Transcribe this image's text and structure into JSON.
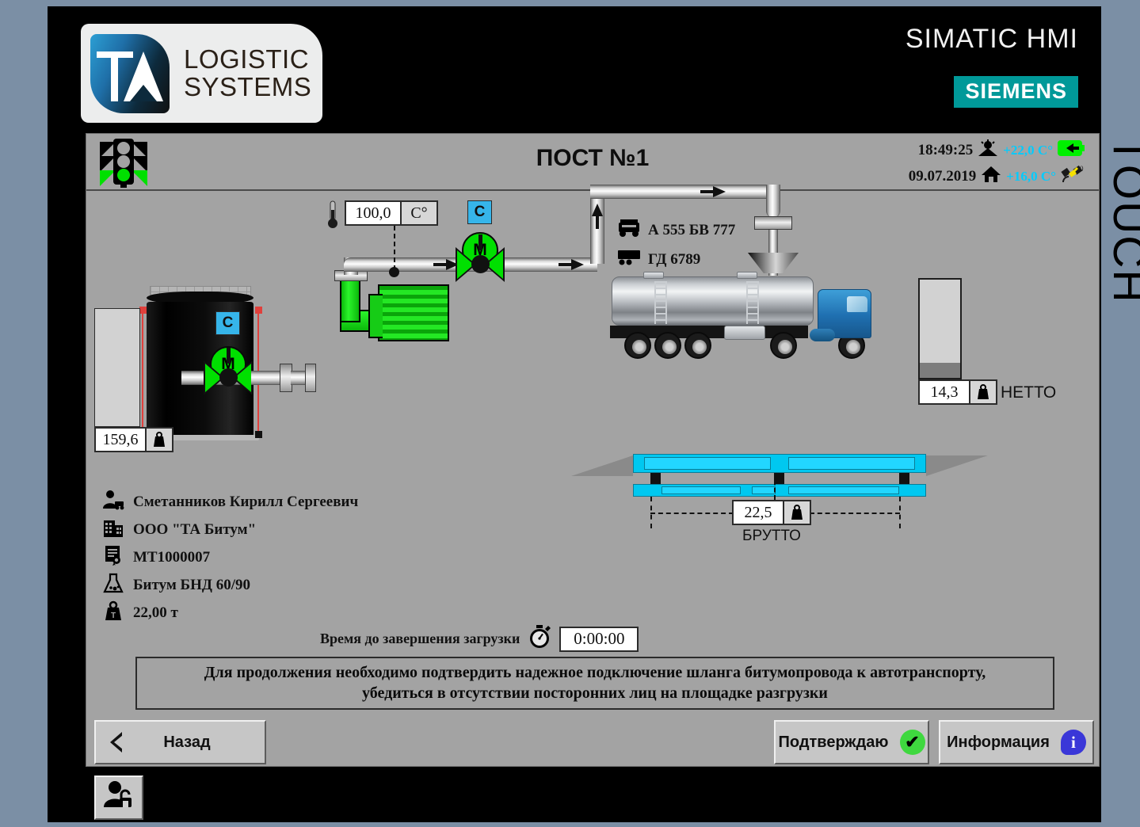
{
  "branding": {
    "logo_line1": "LOGISTIC",
    "logo_line2": "SYSTEMS",
    "logo_mark": "TA",
    "simatic_title": "SIMATIC HMI",
    "siemens": "SIEMENS",
    "touch_label": "TOUCH",
    "accent_teal": "#009999",
    "bezel_color": "#7b8fa5"
  },
  "titlebar": {
    "page_title": "ПОСТ №1",
    "traffic_light_state": "green",
    "time": "18:49:25",
    "date": "09.07.2019",
    "outside_temp": "+22,0 C°",
    "inside_temp": "+16,0 C°",
    "outside_icon": "sunrise-icon",
    "inside_icon": "house-icon",
    "power_icon": "power-plug-icon",
    "satellite_icon": "satellite-icon",
    "satellite_count": "0"
  },
  "process": {
    "tank": {
      "level_value": "159,6",
      "level_icon": "weight-icon",
      "gauge_fill_percent": 0
    },
    "temperature": {
      "value": "100,0",
      "unit": "C°",
      "icon": "thermometer-icon"
    },
    "valve_1": {
      "badge": "C",
      "motor": "M",
      "state": "open"
    },
    "valve_2": {
      "badge": "C",
      "motor": "M",
      "state": "open"
    },
    "pump": {
      "state": "running"
    },
    "vehicle": {
      "truck_plate": "А 555 БВ 777",
      "trailer_plate": "ГД 6789",
      "truck_icon": "truck-cab-icon",
      "trailer_icon": "trailer-icon"
    },
    "netto": {
      "value": "14,3",
      "label": "НЕТТО",
      "icon": "weight-icon",
      "gauge_fill_percent": 15
    },
    "brutto": {
      "value": "22,5",
      "label": "БРУТТО",
      "icon": "weight-icon"
    }
  },
  "order_info": {
    "driver": {
      "icon": "driver-icon",
      "text": "Сметанников Кирилл Сергеевич"
    },
    "company": {
      "icon": "building-icon",
      "text": "ООО \"ТА Битум\""
    },
    "document": {
      "icon": "certificate-icon",
      "text": "МТ1000007"
    },
    "product": {
      "icon": "flask-icon",
      "text": "Битум БНД 60/90"
    },
    "quantity": {
      "icon": "weight-icon",
      "text": "22,00 т"
    }
  },
  "timer": {
    "label": "Время до завершения загрузки",
    "icon": "stopwatch-icon",
    "value": "0:00:00"
  },
  "message": {
    "line1": "Для продолжения необходимо подтвердить надежное подключение шланга битумопровода к автотранспорту,",
    "line2": "убедиться в отсутствии посторонних лиц на площадке разгрузки"
  },
  "buttons": {
    "back": {
      "label": "Назад",
      "icon": "chevron-left-icon"
    },
    "confirm": {
      "label": "Подтверждаю",
      "icon": "check-icon"
    },
    "info": {
      "label": "Информация",
      "icon": "info-icon"
    },
    "user": {
      "icon": "user-unlock-icon"
    }
  }
}
